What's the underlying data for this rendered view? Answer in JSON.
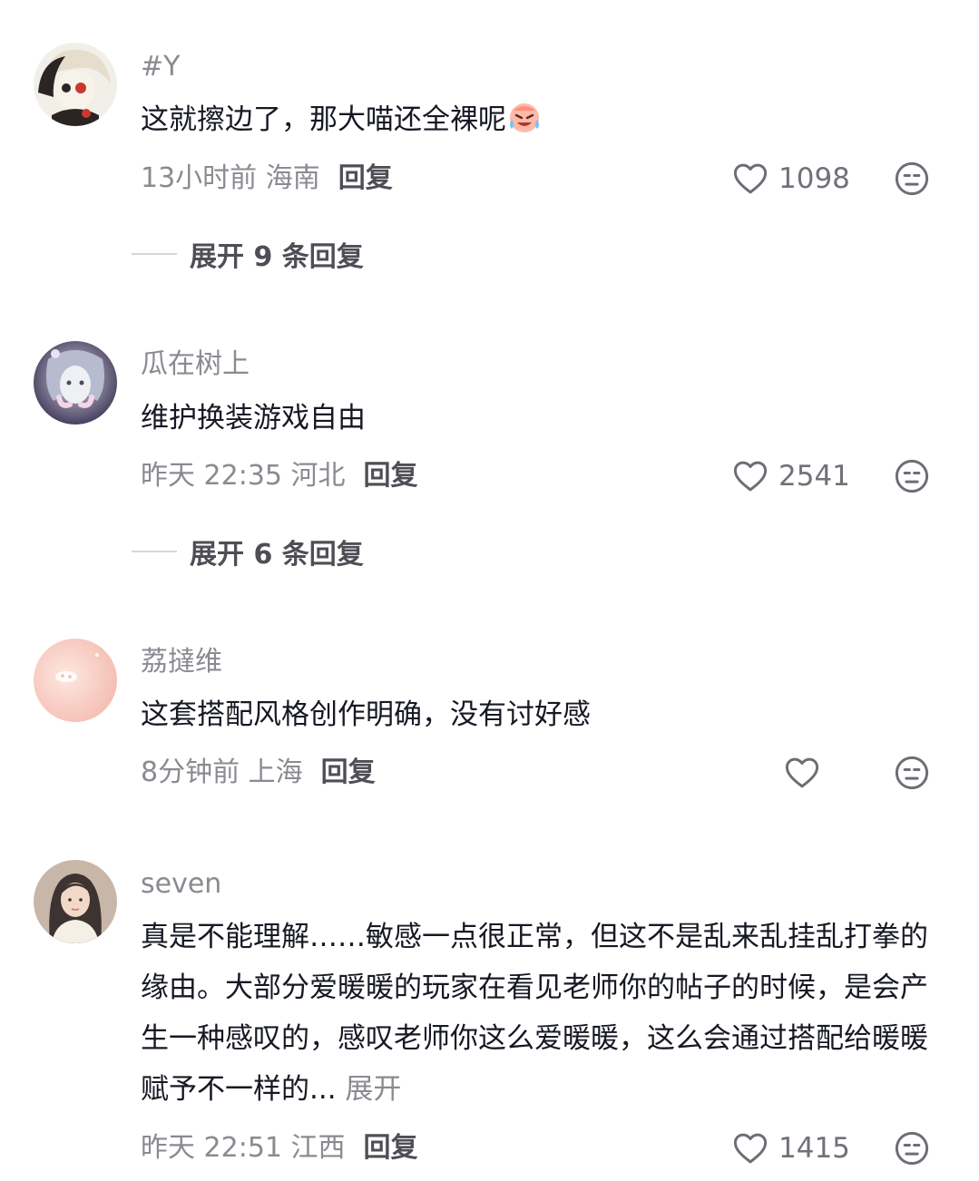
{
  "comments": [
    {
      "username": "#Y",
      "text": "这就擦边了，那大喵还全裸呢",
      "emoji": "crying-laughing-emoji",
      "meta": "13小时前 海南",
      "reply_label": "回复",
      "likes": "1098",
      "expand_label": "展开 9 条回复",
      "avatar_colors": [
        "#e9e3d8",
        "#2b2424",
        "#c9382e"
      ]
    },
    {
      "username": "瓜在树上",
      "text": "维护换装游戏自由",
      "meta": "昨天 22:35 河北",
      "reply_label": "回复",
      "likes": "2541",
      "expand_label": "展开 6 条回复",
      "avatar_colors": [
        "#8f92b5",
        "#3a3454",
        "#d9d3e6"
      ]
    },
    {
      "username": "荔撻维",
      "text": "这套搭配风格创作明确，没有讨好感",
      "meta": "8分钟前 上海",
      "reply_label": "回复",
      "likes": "",
      "avatar_colors": [
        "#f6c7c0",
        "#fbe3dc",
        "#ffffff"
      ]
    },
    {
      "username": "seven",
      "text": "真是不能理解……敏感一点很正常，但这不是乱来乱挂乱打拳的缘由。大部分爱暖暖的玩家在看见老师你的帖子的时候，是会产生一种感叹的，感叹老师你这么爱暖暖，这么会通过搭配给暖暖赋予不一样的...",
      "more_label": "展开",
      "meta": "昨天 22:51 江西",
      "reply_label": "回复",
      "likes": "1415",
      "avatar_colors": [
        "#3d3330",
        "#f1d9c8",
        "#c8b7a8"
      ]
    }
  ],
  "icons": {
    "like": "heart-outline-icon",
    "emoji_reply": "neutral-face-icon"
  },
  "colors": {
    "secondary_text": "#8a8b91",
    "primary_text": "#161823",
    "accent_text": "#4e4f56"
  }
}
